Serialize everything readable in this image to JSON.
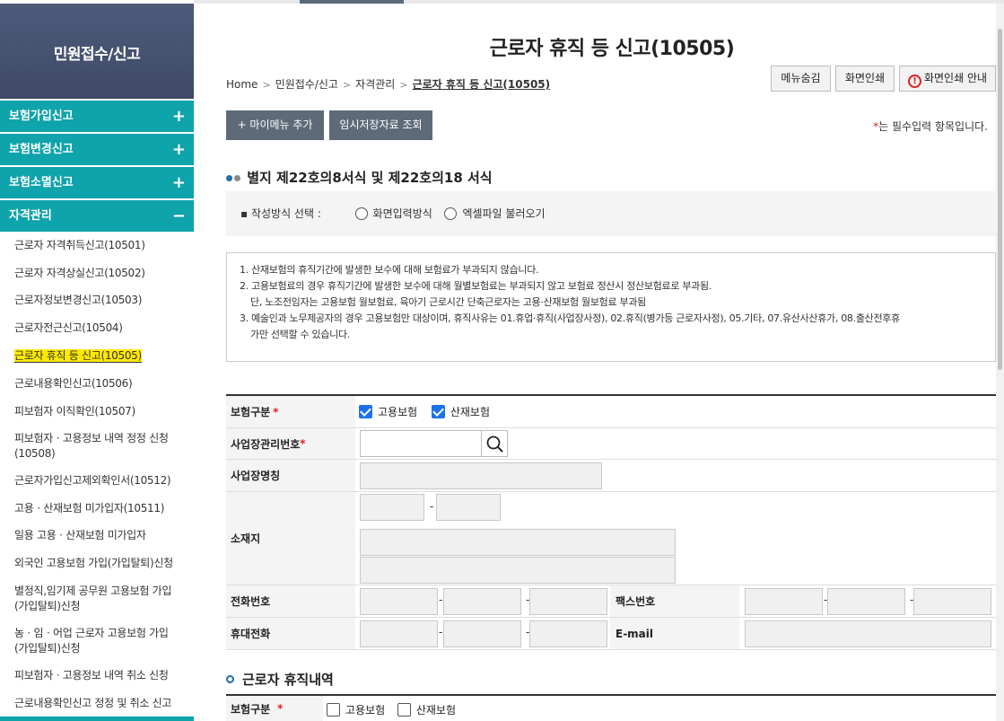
{
  "colors": {
    "accent_teal": "#0fa3ab",
    "sidebar_header": "#4d5b7b",
    "highlight": "#ffe900",
    "required": "#e02020",
    "checkbox": "#1a73e8"
  },
  "sidebar": {
    "title": "민원접수/신고",
    "sections": [
      {
        "label": "보험가입신고",
        "state": "+"
      },
      {
        "label": "보험변경신고",
        "state": "+"
      },
      {
        "label": "보험소멸신고",
        "state": "+"
      },
      {
        "label": "자격관리",
        "state": "−"
      }
    ],
    "items": [
      {
        "label": "근로자 자격취득신고(10501)"
      },
      {
        "label": "근로자 자격상실신고(10502)"
      },
      {
        "label": "근로자정보변경신고(10503)"
      },
      {
        "label": "근로자전근신고(10504)"
      },
      {
        "label": "근로자 휴직 등 신고(10505)",
        "active": true
      },
      {
        "label": "근로내용확인신고(10506)"
      },
      {
        "label": "피보험자 이직확인(10507)"
      },
      {
        "label": "피보험자ㆍ고용정보 내역 정정 신청",
        "label2": "(10508)"
      },
      {
        "label": "근로자가입신고제외확인서(10512)"
      },
      {
        "label": "고용ㆍ산재보험 미가입자(10511)"
      },
      {
        "label": "일용 고용ㆍ산재보험 미가입자"
      },
      {
        "label": "외국인 고용보험 가입(가입탈퇴)신청"
      },
      {
        "label": "별정직,임기제 공무원 고용보험 가입",
        "label2": "(가입탈퇴)신청"
      },
      {
        "label": "농ㆍ임ㆍ어업 근로자 고용보험 가입",
        "label2": "(가입탈퇴)신청"
      },
      {
        "label": "피보험자ㆍ고용정보 내역 취소 신청"
      },
      {
        "label": "근로내용확인신고 정정 및 취소 신고"
      }
    ]
  },
  "page": {
    "title": "근로자 휴직 등 신고(10505)",
    "breadcrumb": [
      "Home",
      "민원접수/신고",
      "자격관리",
      "근로자 휴직 등 신고(10505)"
    ],
    "buttons": {
      "hide_menu": "메뉴숨김",
      "print": "화면인쇄",
      "print_guide": "화면인쇄 안내",
      "add_mymenu": "+ 마이메뉴 추가",
      "temp_saved": "임시저장자료 조회"
    },
    "required_note_star": "*",
    "required_note": "는 필수입력 항목입니다."
  },
  "form_section": {
    "heading": "별지 제22호의8서식 및 제22호의18 서식",
    "method_label": "▪ 작성방식 선택 :",
    "method_options": [
      "화면입력방식",
      "엑셀파일 불러오기"
    ]
  },
  "notice": [
    "1. 산재보험의 휴직기간에 발생한 보수에 대해 보험료가 부과되지 않습니다.",
    "2. 고용보험료의 경우 휴직기간에 발생한 보수에 대해 월별보험료는 부과되지 않고 보험료 정산시 정산보험료로 부과됨.",
    "단, 노조전임자는 고용보험 월보험료, 육아기 근로시간 단축근로자는 고용·산재보험 월보험료 부과됨",
    "3. 예술인과 노무제공자의 경우 고용보험만 대상이며, 휴직사유는 01.휴업·휴직(사업장사정), 02.휴직(병가등 근로자사정), 05.기타, 07.유산사산휴가, 08.출산전후휴",
    "가만 선택할 수 있습니다."
  ],
  "table": {
    "insurance_type_label": "보험구분",
    "insurance_options": [
      "고용보험",
      "산재보험"
    ],
    "biz_no_label": "사업장관리번호",
    "biz_name_label": "사업장명칭",
    "address_label": "소재지",
    "phone_label": "전화번호",
    "fax_label": "팩스번호",
    "mobile_label": "휴대전화",
    "email_label": "E-mail",
    "dash": "-",
    "star": "*"
  },
  "leave_section": {
    "heading": "근로자 휴직내역",
    "insurance_type_label": "보험구분",
    "insurance_options": [
      "고용보험",
      "산재보험"
    ]
  }
}
